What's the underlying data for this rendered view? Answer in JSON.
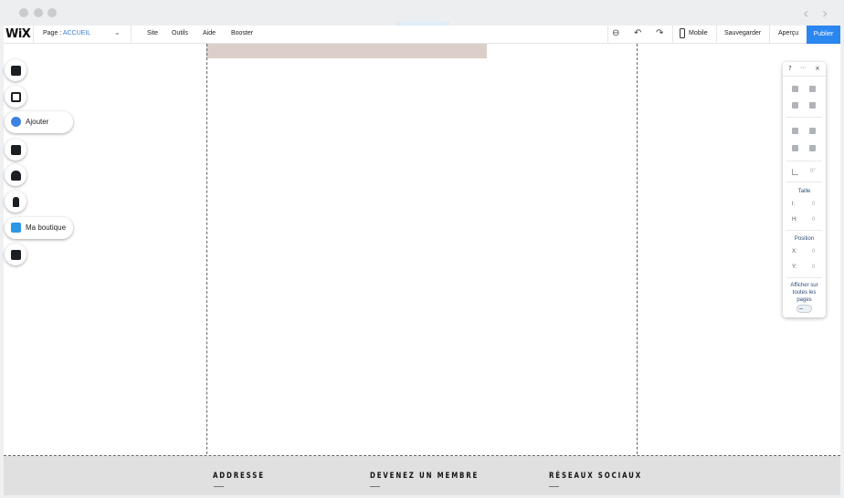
{
  "topbar": {
    "logo": "WiX",
    "page_label": "Page :",
    "page_value": "ACCUEIL",
    "menu": [
      "Site",
      "Outils",
      "Aide",
      "Booster"
    ],
    "mobile_label": "Mobile",
    "save_label": "Sauvegarder",
    "preview_label": "Aperçu",
    "publish_label": "Publier"
  },
  "left_toolbar": {
    "add_label": "Ajouter",
    "shop_label": "Ma boutique"
  },
  "right_panel": {
    "help": "?",
    "close": "×",
    "size_label": "Taille",
    "width_label": "l:",
    "width_value": "0",
    "height_label": "H:",
    "height_value": "0",
    "position_label": "Position",
    "x_label": "X:",
    "x_value": "0",
    "y_label": "Y:",
    "y_value": "0",
    "rotation_value": "0°",
    "show_all_pages": "Afficher sur toutes les pages"
  },
  "footer": {
    "col1": "ADDRESSE",
    "col2": "DEVENEZ UN MEMBRE",
    "col3": "RÉSEAUX SOCIAUX"
  },
  "colors": {
    "publish_bg": "#2b86f0",
    "page_value": "#3b7dd8",
    "header_strip": "#dccfca",
    "footer_bg": "#e0e0e0"
  }
}
